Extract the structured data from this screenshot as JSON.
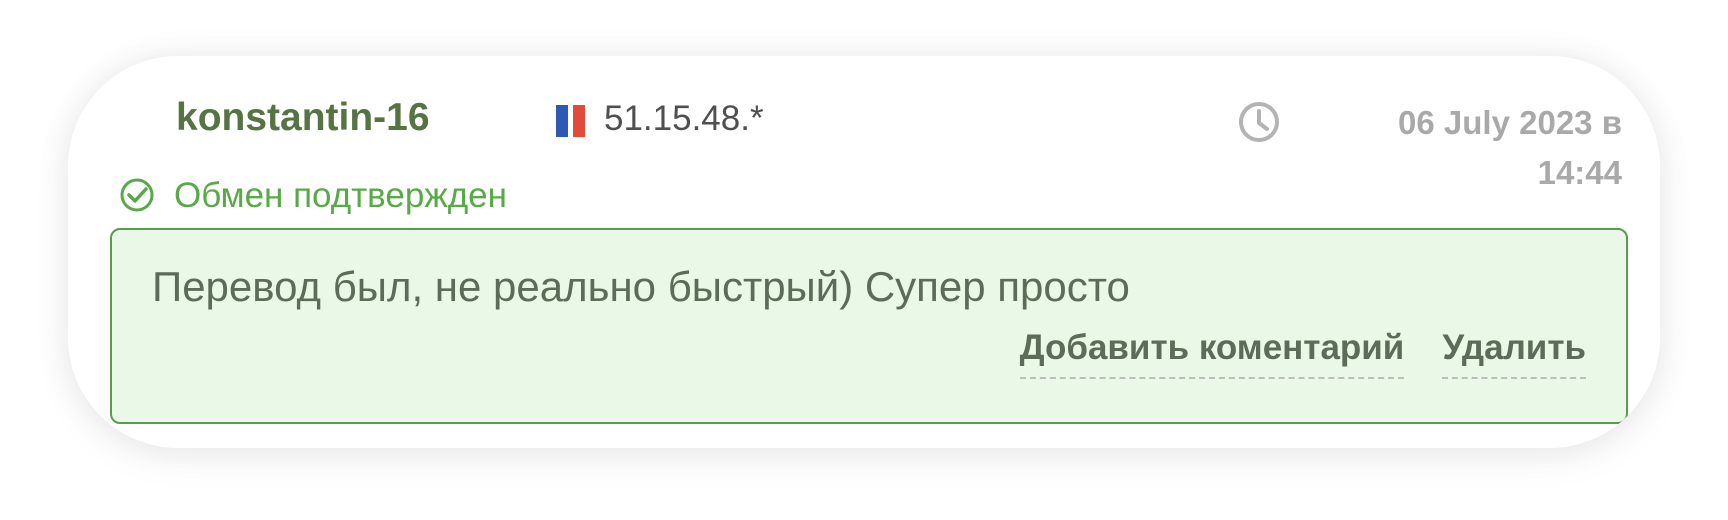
{
  "review": {
    "username": "konstantin-16",
    "ip": "51.15.48.*",
    "country_flag": "France",
    "date_line_1": "06 July 2023 в",
    "date_line_2": "14:44",
    "status": "Обмен подтвержден",
    "comment": "Перевод был, не реально быстрый) Супер просто",
    "actions": {
      "add_comment": "Добавить коментарий",
      "delete": "Удалить"
    }
  },
  "colors": {
    "username": "#567344",
    "status": "#58a947",
    "comment_bg": "#eaf8e7",
    "comment_border": "#5a9a52",
    "date": "#a9a9a9"
  },
  "icons": {
    "clock": "clock-icon",
    "status": "check-circle-icon",
    "flag": "france-flag-icon"
  }
}
